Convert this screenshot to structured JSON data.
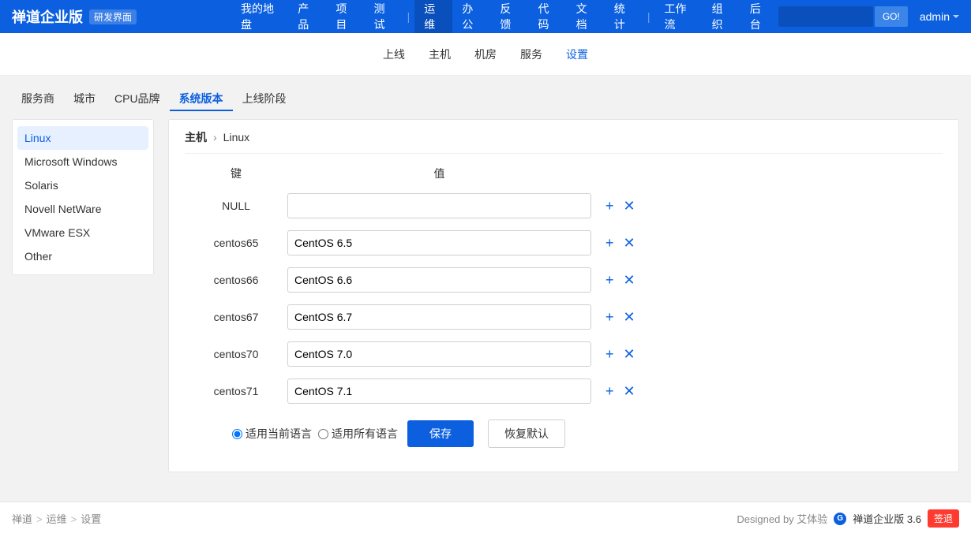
{
  "brand": {
    "name": "禅道企业版",
    "tag": "研发界面"
  },
  "topnav": {
    "items": [
      "我的地盘",
      "产品",
      "项目",
      "测试",
      "运维",
      "办公",
      "反馈",
      "代码",
      "文档",
      "统计",
      "工作流",
      "组织",
      "后台"
    ],
    "active_index": 4,
    "sep_before": [
      4,
      10
    ]
  },
  "search": {
    "go": "GO!"
  },
  "user": {
    "name": "admin"
  },
  "subnav": {
    "items": [
      "上线",
      "主机",
      "机房",
      "服务",
      "设置"
    ],
    "active_index": 4
  },
  "tabs": {
    "items": [
      "服务商",
      "城市",
      "CPU品牌",
      "系统版本",
      "上线阶段"
    ],
    "active_index": 3
  },
  "sidebar": {
    "items": [
      "Linux",
      "Microsoft Windows",
      "Solaris",
      "Novell NetWare",
      "VMware ESX",
      "Other"
    ],
    "active_index": 0
  },
  "breadcrumb": {
    "root": "主机",
    "current": "Linux"
  },
  "table": {
    "headers": {
      "key": "键",
      "value": "值"
    },
    "rows": [
      {
        "key": "NULL",
        "value": ""
      },
      {
        "key": "centos65",
        "value": "CentOS 6.5"
      },
      {
        "key": "centos66",
        "value": "CentOS 6.6"
      },
      {
        "key": "centos67",
        "value": "CentOS 6.7"
      },
      {
        "key": "centos70",
        "value": "CentOS 7.0"
      },
      {
        "key": "centos71",
        "value": "CentOS 7.1"
      }
    ]
  },
  "form": {
    "radio_current": "适用当前语言",
    "radio_all": "适用所有语言",
    "save": "保存",
    "restore": "恢复默认"
  },
  "footer": {
    "crumb": [
      "禅道",
      "运维",
      "设置"
    ],
    "designed_by": "Designed by 艾体验",
    "version": "禅道企业版 3.6",
    "logout": "签退"
  }
}
